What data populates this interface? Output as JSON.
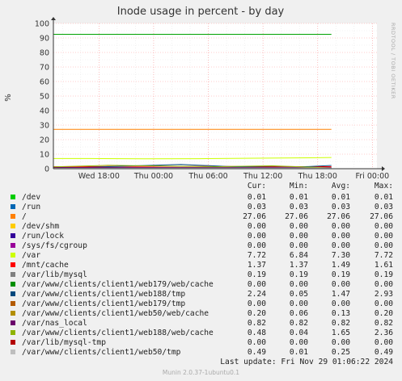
{
  "chart_data": {
    "type": "line",
    "title": "Inode usage in percent - by day",
    "ylabel": "%",
    "xlabel": "",
    "ylim": [
      0,
      100
    ],
    "yticks": [
      0,
      10,
      20,
      30,
      40,
      50,
      60,
      70,
      80,
      90,
      100
    ],
    "xlim": [
      0,
      30.5
    ],
    "x_unit": "hours since Wed 13:00",
    "xticks": [
      {
        "x": 5,
        "label": "Wed 18:00"
      },
      {
        "x": 11,
        "label": "Thu 00:00"
      },
      {
        "x": 17,
        "label": "Thu 06:00"
      },
      {
        "x": 23,
        "label": "Thu 12:00"
      },
      {
        "x": 29,
        "label": "Thu 18:00"
      },
      {
        "x": 35,
        "label": "Fri 00:00"
      }
    ],
    "grid": true,
    "watermark": "RRDTOOL / TOBI OETIKER",
    "series": [
      {
        "name": "/dev",
        "color": "#00cc00",
        "x": [
          0,
          30.5
        ],
        "y": [
          0.01,
          0.01
        ]
      },
      {
        "name": "/run",
        "color": "#0066b3",
        "x": [
          0,
          30.5
        ],
        "y": [
          0.03,
          0.03
        ]
      },
      {
        "name": "/",
        "color": "#ff8000",
        "x": [
          0,
          30.5
        ],
        "y": [
          27.06,
          27.06
        ]
      },
      {
        "name": "/dev/shm",
        "color": "#ffcc00",
        "x": [
          0,
          30.5
        ],
        "y": [
          0.0,
          0.0
        ]
      },
      {
        "name": "/run/lock",
        "color": "#330099",
        "x": [
          0,
          30.5
        ],
        "y": [
          0.0,
          0.0
        ]
      },
      {
        "name": "/sys/fs/cgroup",
        "color": "#990099",
        "x": [
          0,
          30.5
        ],
        "y": [
          0.0,
          0.0
        ]
      },
      {
        "name": "/var",
        "color": "#ccff00",
        "x": [
          0,
          4,
          10,
          16,
          22,
          28,
          30.5
        ],
        "y": [
          7.0,
          7.0,
          6.84,
          6.9,
          7.2,
          7.5,
          7.72
        ]
      },
      {
        "name": "/mnt/cache",
        "color": "#ff0000",
        "x": [
          0,
          6,
          12,
          18,
          24,
          30.5
        ],
        "y": [
          1.4,
          1.5,
          1.6,
          1.5,
          1.45,
          1.37
        ]
      },
      {
        "name": "/var/lib/mysql",
        "color": "#808080",
        "x": [
          0,
          30.5
        ],
        "y": [
          0.19,
          0.19
        ]
      },
      {
        "name": "/var/www/clients/client1/web179/web/cache",
        "color": "#008f00",
        "x": [
          0,
          30.5
        ],
        "y": [
          0.0,
          0.0
        ]
      },
      {
        "name": "/var/www/clients/client1/web188/tmp",
        "color": "#00487d",
        "x": [
          0,
          3,
          8,
          14,
          20,
          26,
          30.5
        ],
        "y": [
          0.5,
          0.8,
          1.8,
          2.93,
          1.3,
          0.9,
          2.24
        ]
      },
      {
        "name": "/var/www/clients/client1/web179/tmp",
        "color": "#b35a00",
        "x": [
          0,
          30.5
        ],
        "y": [
          0.0,
          0.0
        ]
      },
      {
        "name": "/var/www/clients/client1/web50/web/cache",
        "color": "#b38f00",
        "x": [
          0,
          30.5
        ],
        "y": [
          0.13,
          0.2
        ]
      },
      {
        "name": "/var/nas_local",
        "color": "#6b006b",
        "x": [
          0,
          30.5
        ],
        "y": [
          0.82,
          0.82
        ]
      },
      {
        "name": "/var/www/clients/client1/web188/web/cache",
        "color": "#8fb300",
        "x": [
          0,
          6,
          12,
          18,
          24,
          30.5
        ],
        "y": [
          1.2,
          2.36,
          1.8,
          1.4,
          2.0,
          0.48
        ]
      },
      {
        "name": "/var/lib/mysql-tmp",
        "color": "#b30000",
        "x": [
          0,
          30.5
        ],
        "y": [
          0.0,
          0.0
        ]
      },
      {
        "name": "/var/www/clients/client1/web50/tmp",
        "color": "#bebebe",
        "x": [
          0,
          30.5
        ],
        "y": [
          0.3,
          0.49
        ]
      },
      {
        "name": "",
        "color": "#00a000",
        "x": [
          0,
          30.5
        ],
        "y": [
          92.5,
          92.5
        ]
      }
    ]
  },
  "legend": {
    "headers": [
      "Cur:",
      "Min:",
      "Avg:",
      "Max:"
    ],
    "rows": [
      {
        "name": "/dev",
        "color": "#00cc00",
        "cur": "0.01",
        "min": "0.01",
        "avg": "0.01",
        "max": "0.01"
      },
      {
        "name": "/run",
        "color": "#0066b3",
        "cur": "0.03",
        "min": "0.03",
        "avg": "0.03",
        "max": "0.03"
      },
      {
        "name": "/",
        "color": "#ff8000",
        "cur": "27.06",
        "min": "27.06",
        "avg": "27.06",
        "max": "27.06"
      },
      {
        "name": "/dev/shm",
        "color": "#ffcc00",
        "cur": "0.00",
        "min": "0.00",
        "avg": "0.00",
        "max": "0.00"
      },
      {
        "name": "/run/lock",
        "color": "#330099",
        "cur": "0.00",
        "min": "0.00",
        "avg": "0.00",
        "max": "0.00"
      },
      {
        "name": "/sys/fs/cgroup",
        "color": "#990099",
        "cur": "0.00",
        "min": "0.00",
        "avg": "0.00",
        "max": "0.00"
      },
      {
        "name": "/var",
        "color": "#ccff00",
        "cur": "7.72",
        "min": "6.84",
        "avg": "7.30",
        "max": "7.72"
      },
      {
        "name": "/mnt/cache",
        "color": "#ff0000",
        "cur": "1.37",
        "min": "1.37",
        "avg": "1.49",
        "max": "1.61"
      },
      {
        "name": "/var/lib/mysql",
        "color": "#808080",
        "cur": "0.19",
        "min": "0.19",
        "avg": "0.19",
        "max": "0.19"
      },
      {
        "name": "/var/www/clients/client1/web179/web/cache",
        "color": "#008f00",
        "cur": "0.00",
        "min": "0.00",
        "avg": "0.00",
        "max": "0.00"
      },
      {
        "name": "/var/www/clients/client1/web188/tmp",
        "color": "#00487d",
        "cur": "2.24",
        "min": "0.05",
        "avg": "1.47",
        "max": "2.93"
      },
      {
        "name": "/var/www/clients/client1/web179/tmp",
        "color": "#b35a00",
        "cur": "0.00",
        "min": "0.00",
        "avg": "0.00",
        "max": "0.00"
      },
      {
        "name": "/var/www/clients/client1/web50/web/cache",
        "color": "#b38f00",
        "cur": "0.20",
        "min": "0.06",
        "avg": "0.13",
        "max": "0.20"
      },
      {
        "name": "/var/nas_local",
        "color": "#6b006b",
        "cur": "0.82",
        "min": "0.82",
        "avg": "0.82",
        "max": "0.82"
      },
      {
        "name": "/var/www/clients/client1/web188/web/cache",
        "color": "#8fb300",
        "cur": "0.48",
        "min": "0.04",
        "avg": "1.65",
        "max": "2.36"
      },
      {
        "name": "/var/lib/mysql-tmp",
        "color": "#b30000",
        "cur": "0.00",
        "min": "0.00",
        "avg": "0.00",
        "max": "0.00"
      },
      {
        "name": "/var/www/clients/client1/web50/tmp",
        "color": "#bebebe",
        "cur": "0.49",
        "min": "0.01",
        "avg": "0.25",
        "max": "0.49"
      }
    ],
    "last_update": "Last update: Fri Nov 29 01:06:22 2024"
  },
  "footer": "Munin 2.0.37-1ubuntu0.1"
}
